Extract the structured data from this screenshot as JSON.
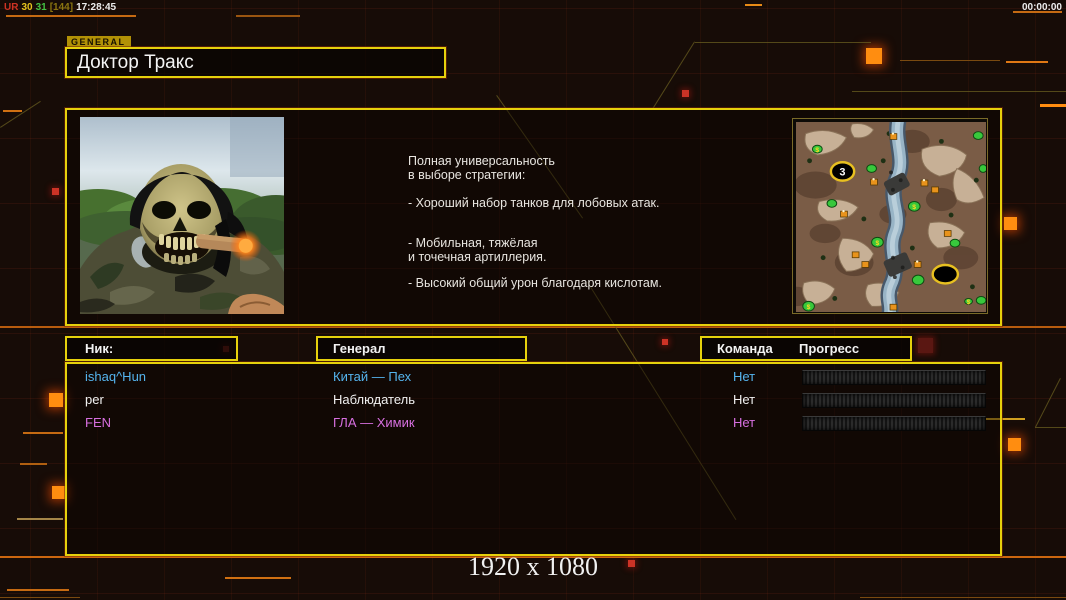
{
  "status_bar": {
    "debug": {
      "tag": "UR",
      "fps": "30",
      "val2": "31",
      "bracket": "[144]",
      "clock": "17:28:45"
    },
    "timer": "00:00:00"
  },
  "general_tab": "GENERAL",
  "title": "Доктор Тракс",
  "description": {
    "para1": [
      "Полная универсальность",
      "в выборе стратегии:"
    ],
    "para2": [
      "- Хороший набор танков для лобовых атак."
    ],
    "para3": [
      "- Мобильная, тяжёлая",
      "и точечная артиллерия."
    ],
    "para4": [
      "- Высокий общий урон благодаря кислотам."
    ]
  },
  "minimap": {
    "start_label": "3"
  },
  "table": {
    "headers": {
      "nick": "Ник:",
      "general": "Генерал",
      "team": "Команда",
      "progress": "Прогресс"
    },
    "rows": [
      {
        "nick": "ishaq^Hun",
        "general": "Китай — Пех",
        "team": "Нет"
      },
      {
        "nick": "per",
        "general": "Наблюдатель",
        "team": "Нет"
      },
      {
        "nick": "FEN",
        "general": "ГЛА — Химик",
        "team": "Нет"
      }
    ]
  },
  "resolution_label": "1920 x 1080",
  "colors": {
    "panel_border": "#e6d10c",
    "accent_orange": "#ff8d10",
    "line_orange": "#c56a12",
    "player_cyan": "#55b4ee",
    "player_white": "#f1f1f1",
    "player_magenta": "#d76fe0",
    "tab_background": "#b29106"
  }
}
